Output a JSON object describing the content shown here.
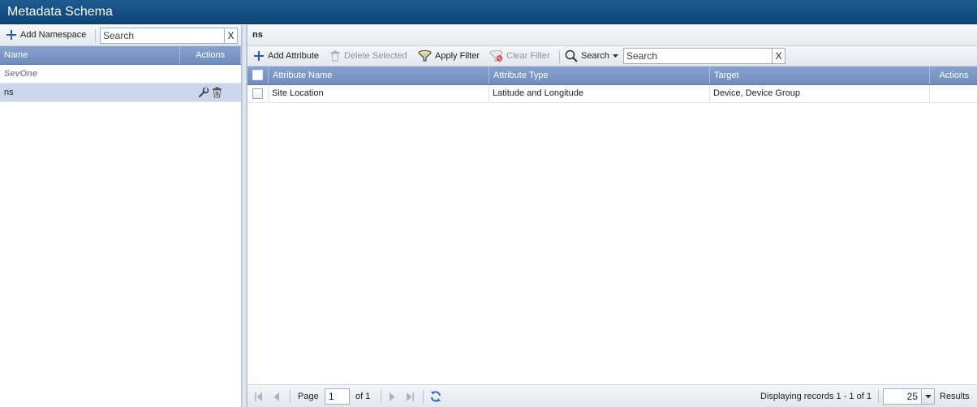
{
  "window": {
    "title": "Metadata Schema"
  },
  "namespace_panel": {
    "add_label": "Add Namespace",
    "search_placeholder": "Search",
    "clear_label": "X",
    "columns": [
      "Name",
      "Actions"
    ],
    "rows": [
      {
        "name": "SevOne",
        "type": "group"
      },
      {
        "name": "ns",
        "type": "item",
        "selected": true
      }
    ]
  },
  "attribute_panel": {
    "title": "ns",
    "toolbar": {
      "add_label": "Add Attribute",
      "delete_label": "Delete Selected",
      "apply_filter_label": "Apply Filter",
      "clear_filter_label": "Clear Filter",
      "search_menu_label": "Search",
      "search_placeholder": "Search",
      "clear_label": "X"
    },
    "columns": [
      "Attribute Name",
      "Attribute Type",
      "Target",
      "Actions"
    ],
    "rows": [
      {
        "attribute_name": "Site Location",
        "attribute_type": "Latitude and Longitude",
        "target": "Device, Device Group",
        "actions": ""
      }
    ],
    "pager": {
      "page_label": "Page",
      "page_value": "1",
      "of_label": "of 1",
      "display_text": "Displaying records 1 - 1 of 1",
      "page_size": "25",
      "results_label": "Results"
    }
  },
  "colors": {
    "title_bar": "#0f4678",
    "grid_header": "#7a95c4",
    "selected_row": "#c9d6ec",
    "add_icon": "#2b5f99"
  }
}
